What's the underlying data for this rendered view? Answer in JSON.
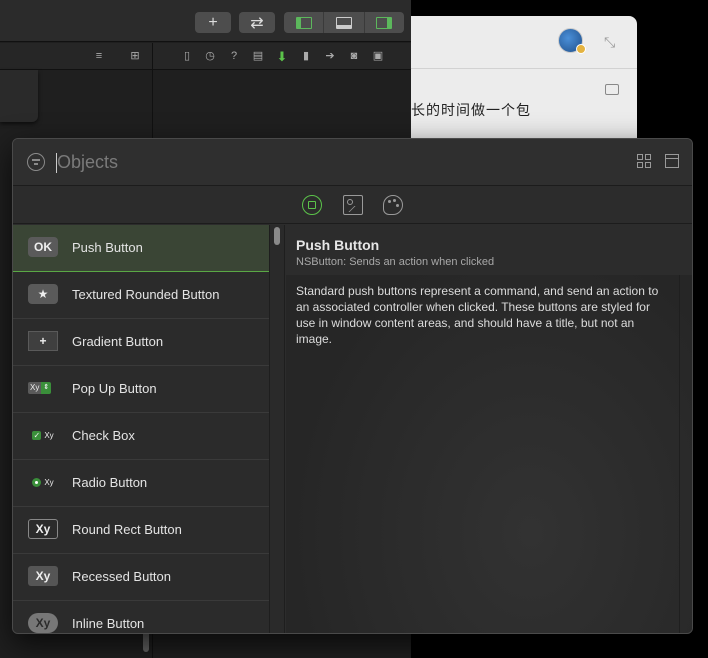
{
  "library": {
    "search_placeholder": "Objects",
    "items": [
      {
        "label": "Push Button",
        "icon_text": "OK"
      },
      {
        "label": "Textured Rounded Button",
        "icon_text": "★"
      },
      {
        "label": "Gradient Button",
        "icon_text": "+"
      },
      {
        "label": "Pop Up Button",
        "icon_text": "Xy"
      },
      {
        "label": "Check Box",
        "icon_text": "Xy"
      },
      {
        "label": "Radio Button",
        "icon_text": "Xy"
      },
      {
        "label": "Round Rect Button",
        "icon_text": "Xy"
      },
      {
        "label": "Recessed Button",
        "icon_text": "Xy"
      },
      {
        "label": "Inline Button",
        "icon_text": "Xy"
      }
    ],
    "selected_item": "Push Button",
    "detail": {
      "title": "Push Button",
      "subtitle": "NSButton: Sends an action when clicked",
      "description": "Standard push buttons represent a command, and send an action to an associated controller when clicked. These buttons are styled for use in window content areas, and should have a title, but not an image."
    }
  },
  "toolbar": {
    "add_label": "+",
    "swap_label": "⇄"
  },
  "background_window": {
    "partial_text": "长的时间做一个包"
  },
  "colors": {
    "accent": "#5bc34a",
    "selection_bg": "#3a4535",
    "panel_bg": "#2c2c2c"
  }
}
